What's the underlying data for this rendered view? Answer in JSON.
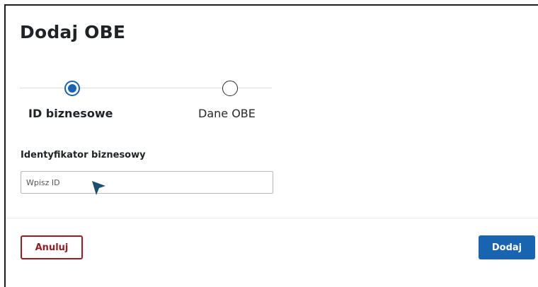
{
  "dialog": {
    "title": "Dodaj OBE"
  },
  "stepper": {
    "steps": [
      {
        "label": "ID biznesowe",
        "state": "active"
      },
      {
        "label": "Dane OBE",
        "state": "inactive"
      }
    ]
  },
  "form": {
    "business_id": {
      "label": "Identyfikator biznesowy",
      "placeholder": "Wpisz ID",
      "value": ""
    }
  },
  "footer": {
    "cancel_label": "Anuluj",
    "add_label": "Dodaj"
  },
  "colors": {
    "primary": "#1864b0",
    "danger": "#9b1b22",
    "text": "#1f2328"
  }
}
